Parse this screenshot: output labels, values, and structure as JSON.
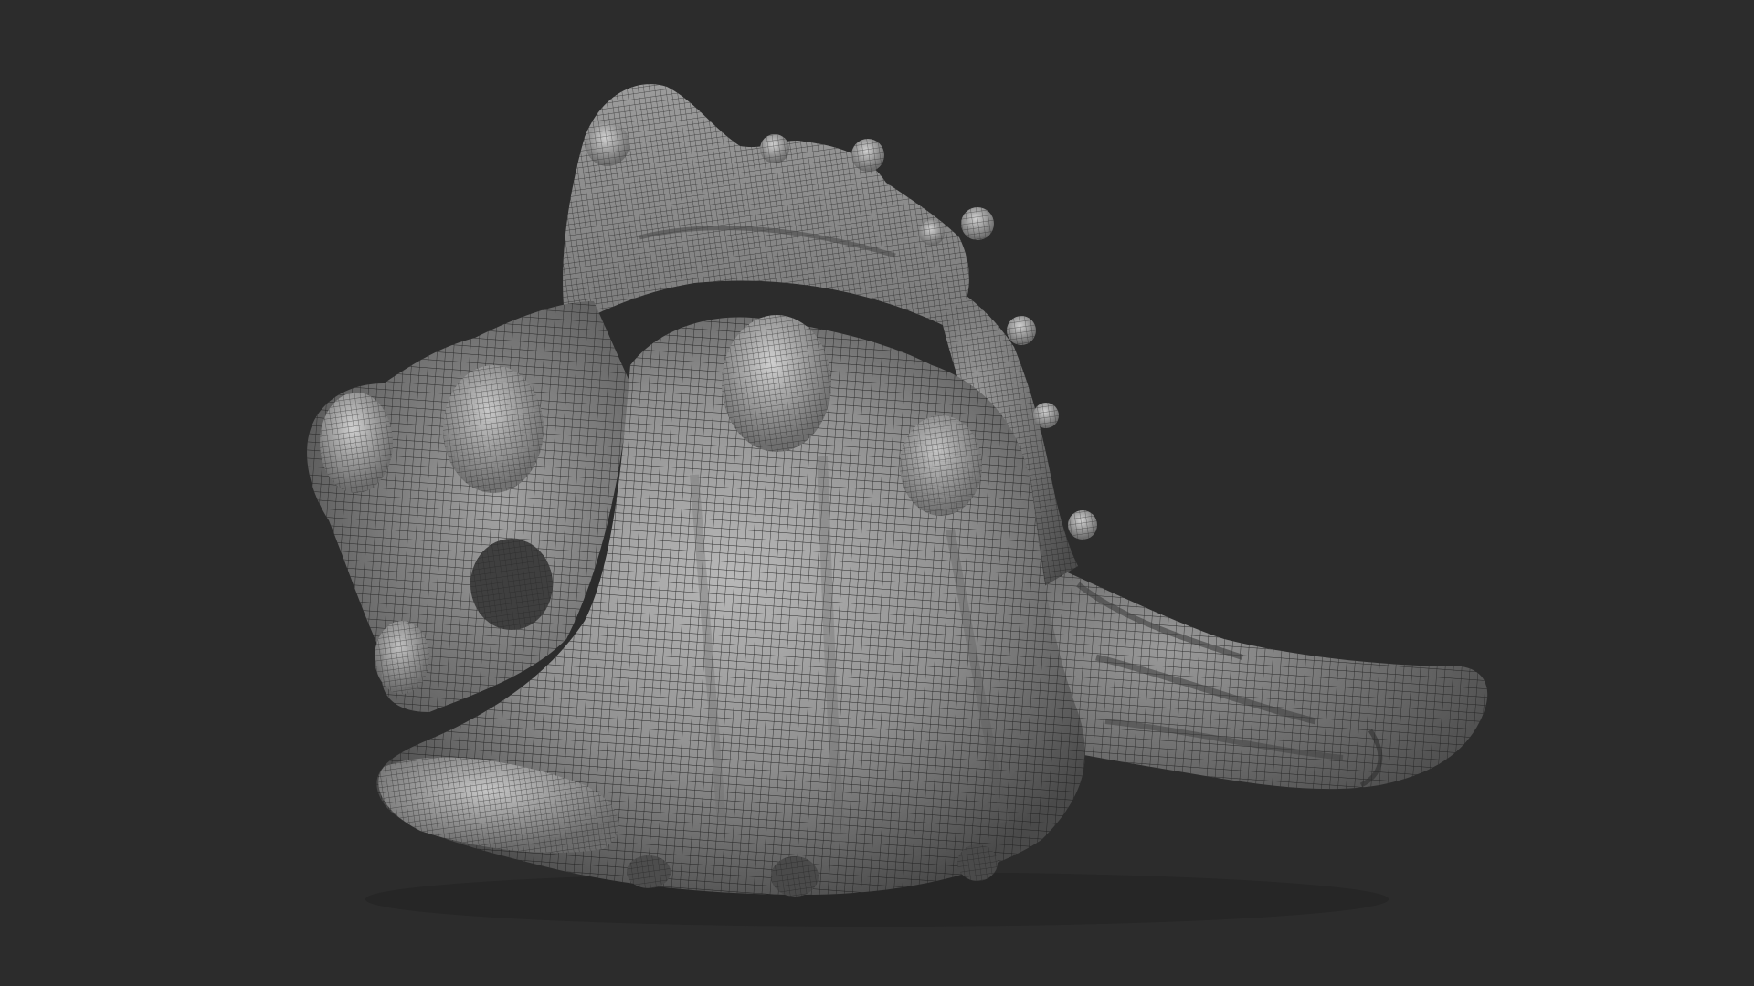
{
  "viewport": {
    "background_color": "#2c2c2c"
  },
  "model": {
    "subject": "seashell-wireframe-mesh",
    "surface_color": "#8e8e8e",
    "highlight_color": "#bdbdbd",
    "shadow_color": "#3a3a3a",
    "wire_color": "#1a1a1a"
  }
}
